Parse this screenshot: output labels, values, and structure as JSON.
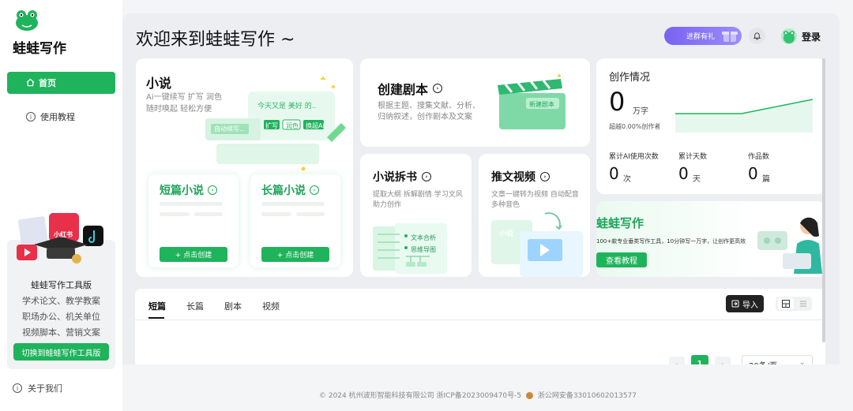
{
  "sidebar": {
    "brand": "蛙蛙写作",
    "nav": [
      {
        "label": "首页",
        "icon": "home-icon"
      },
      {
        "label": "使用教程",
        "icon": "info-icon"
      }
    ],
    "promo": {
      "badge": "小红书",
      "title": "蛙蛙写作工具版",
      "lines": [
        "学术论文、教学教案",
        "职场办公、机关单位",
        "视频脚本、营销文案"
      ],
      "button": "切换到蛙蛙写作工具版"
    },
    "about": "关于我们"
  },
  "header": {
    "welcome": "欢迎来到蛙蛙写作 ~",
    "join_label": "进群有礼",
    "login": "登录"
  },
  "novel": {
    "title": "小说",
    "desc1": "Ai一键续写 扩写 润色",
    "desc2": "随时唤起 轻松方便",
    "illus": {
      "bubble": "今天又是 美好 的..",
      "chips": [
        "扩写",
        "润色",
        "换超Ai"
      ],
      "tag": "自动续写..."
    },
    "short": {
      "title": "短篇小说",
      "button": "+ 点击创建"
    },
    "long": {
      "title": "长篇小说",
      "button": "+ 点击创建"
    }
  },
  "script": {
    "title": "创建剧本",
    "desc1": "根据主题、搜集文献、分析、",
    "desc2": "归纳叙述，创作剧本及文案",
    "illus_label": "新建剧本"
  },
  "split": {
    "title": "小说拆书",
    "desc1": "提取大纲 拆解剧情 学习文风",
    "desc2": "助力创作",
    "illus": [
      "文本合析",
      "思维导图"
    ]
  },
  "video": {
    "title": "推文视频",
    "desc1": "文章一键转为视频 自动配音",
    "desc2": "多种音色",
    "illus_label": "小说"
  },
  "stats": {
    "title": "创作情况",
    "count": "0",
    "count_unit": "万字",
    "beat": "超越0.00%创作者",
    "items": [
      {
        "label": "累计AI使用次数",
        "value": "0",
        "unit": "次"
      },
      {
        "label": "累计天数",
        "value": "0",
        "unit": "天"
      },
      {
        "label": "作品数",
        "value": "0",
        "unit": "篇"
      }
    ]
  },
  "banner": {
    "title": "蛙蛙写作",
    "desc": "100+款专业垂类写作工具，10分钟写一万字，让创作更高效",
    "button": "查看教程"
  },
  "works": {
    "tabs": [
      "短篇",
      "长篇",
      "剧本",
      "视频"
    ],
    "active_tab": "短篇",
    "import": "导入",
    "page": "1",
    "page_size": "20条/页"
  },
  "footer": {
    "copyright": "© 2024 杭州波形智能科技有限公司 浙ICP备2023009470号-5",
    "police": "浙公网安备33010602013577"
  },
  "colors": {
    "accent": "#1fb35c",
    "purple": "#7a62f2"
  }
}
